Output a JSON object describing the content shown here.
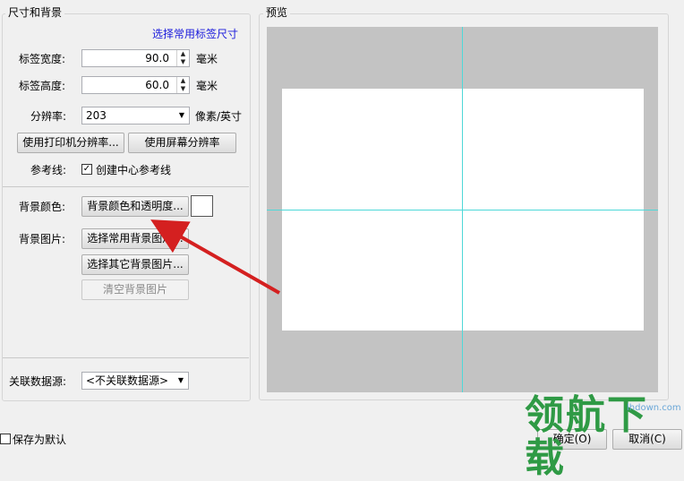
{
  "left_panel": {
    "title": "尺寸和背景",
    "select_common_size_link": "选择常用标签尺寸",
    "width": {
      "label": "标签宽度:",
      "value": "90.0",
      "unit": "毫米"
    },
    "height": {
      "label": "标签高度:",
      "value": "60.0",
      "unit": "毫米"
    },
    "resolution": {
      "label": "分辨率:",
      "value": "203",
      "unit": "像素/英寸"
    },
    "printer_res_button": "使用打印机分辨率...",
    "screen_res_button": "使用屏幕分辨率",
    "guides": {
      "label": "参考线:",
      "checkbox_label": "创建中心参考线",
      "checked": true,
      "check_mark": "✓"
    },
    "bg_color": {
      "label": "背景颜色:",
      "button": "背景颜色和透明度...",
      "swatch_color": "#ffffff"
    },
    "bg_image": {
      "label": "背景图片:",
      "common_button": "选择常用背景图片...",
      "other_button": "选择其它背景图片...",
      "clear_button": "清空背景图片"
    },
    "datasource": {
      "label": "关联数据源:",
      "value": "<不关联数据源>"
    }
  },
  "preview": {
    "title": "预览",
    "background_color": "#c3c3c3",
    "label_color": "#ffffff",
    "guide_color": "#4ed8d8"
  },
  "footer": {
    "save_default_label": "保存为默认",
    "save_default_checked": false,
    "ok_button": "确定(O)",
    "cancel_button": "取消(C)"
  },
  "annotation": {
    "arrow_color": "#d42020"
  },
  "watermark": {
    "text": "领航下载",
    "url": "lhdown.com"
  }
}
